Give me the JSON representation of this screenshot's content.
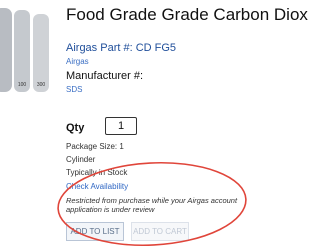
{
  "product": {
    "title": "Food Grade Grade Carbon Diox",
    "part_label": "Airgas Part #:",
    "part_number": "CD FG5",
    "brand": "Airgas",
    "manufacturer_label": "Manufacturer #:",
    "sds_link": "SDS"
  },
  "cylinder_images": {
    "labels": [
      "100",
      "300"
    ]
  },
  "order": {
    "qty_label": "Qty",
    "qty_value": "1",
    "package_size": "Package Size: 1",
    "container": "Cylinder",
    "stock_status": "Typically in Stock",
    "check_availability": "Check Availability",
    "restriction_notice": "Restricted from purchase while your Airgas account application is under review",
    "add_to_list": "ADD TO LIST",
    "add_to_cart": "ADD TO CART"
  },
  "colors": {
    "link": "#3b6fc4",
    "annotation": "#e0453a",
    "disabled_button": "#c0c8d4"
  }
}
